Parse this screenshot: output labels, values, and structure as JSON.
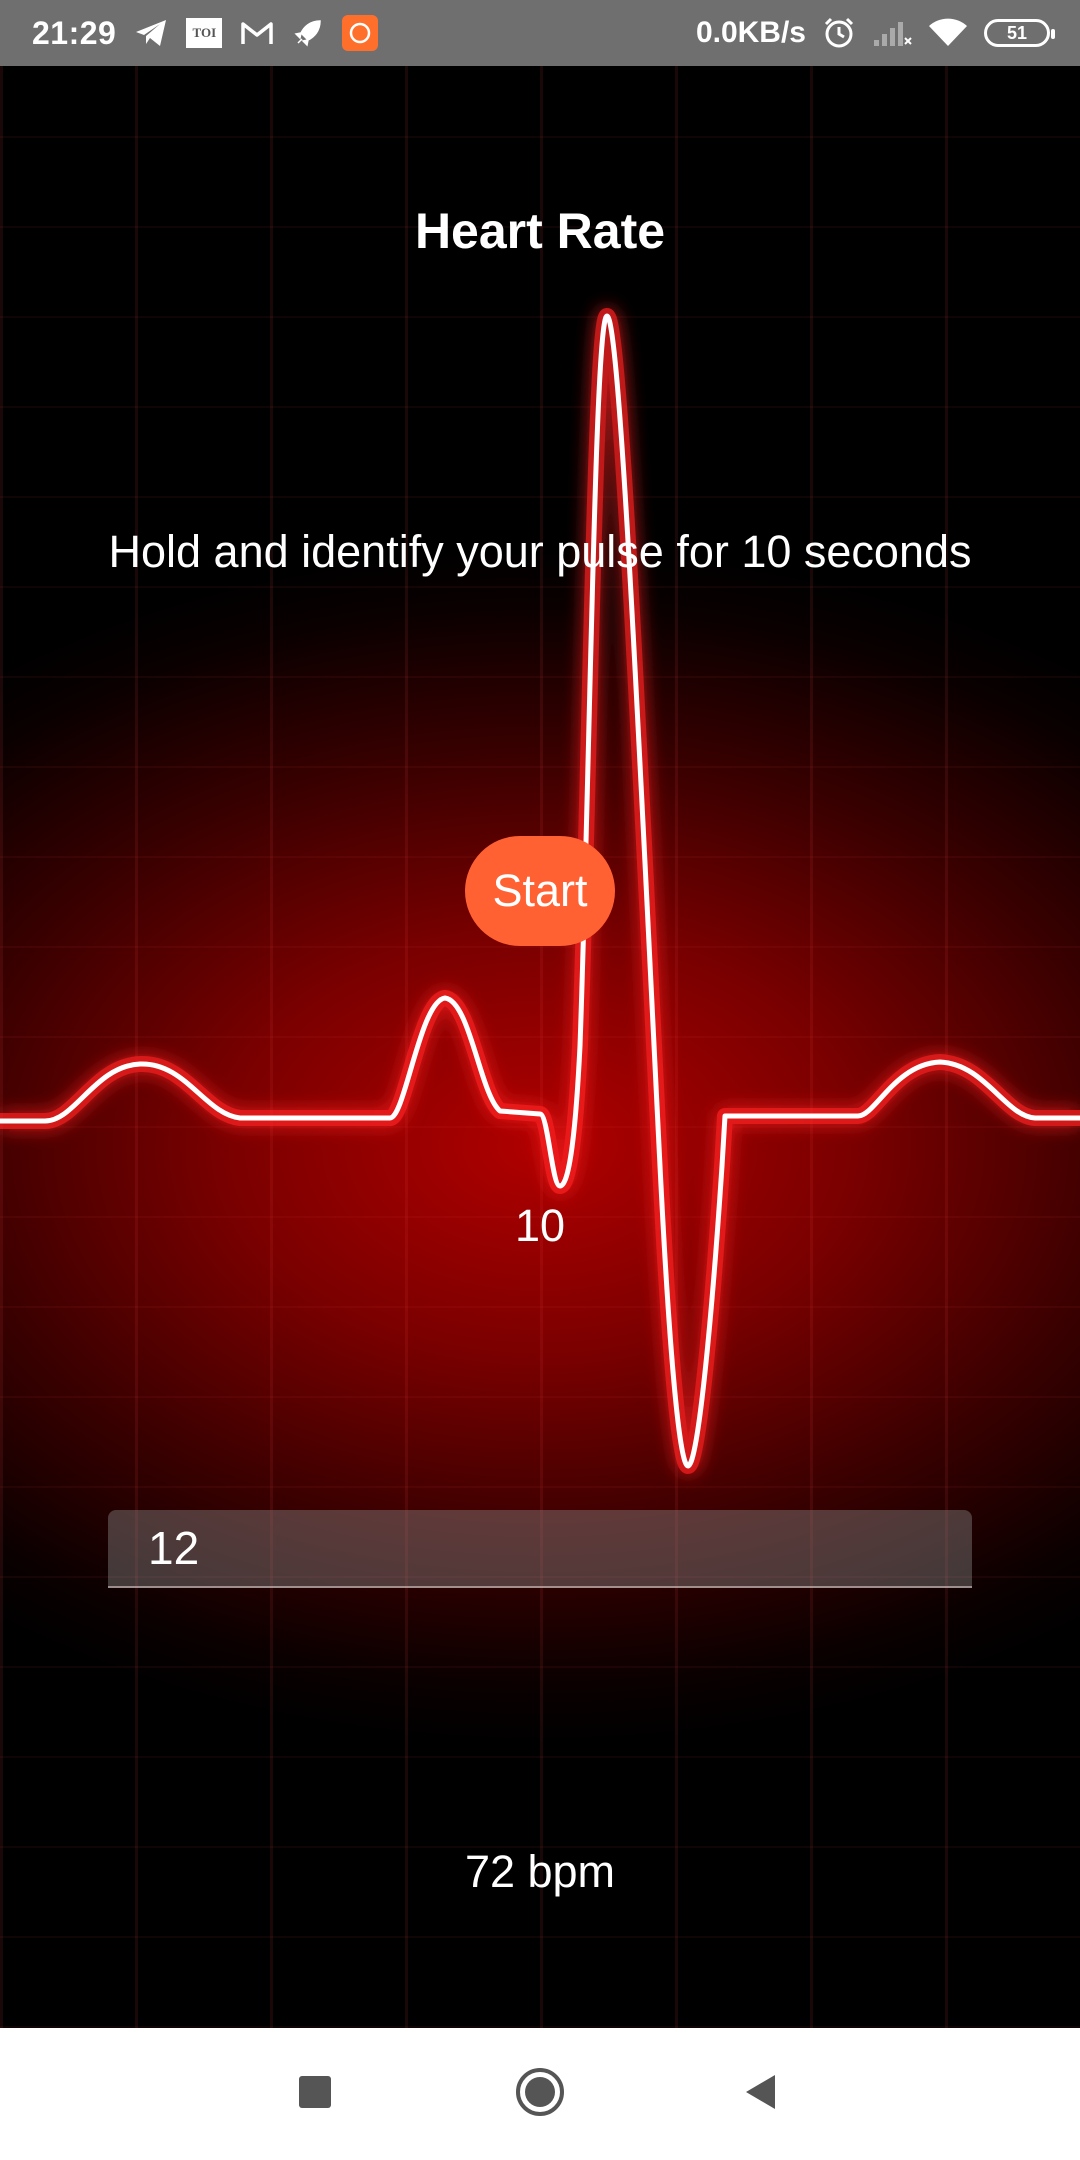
{
  "status_bar": {
    "time": "21:29",
    "toi_label": "TOI",
    "net_speed": "0.0KB/s",
    "battery": "51",
    "icons": [
      "telegram-icon",
      "toi-icon",
      "gmail-icon",
      "rocket-icon",
      "mi-icon",
      "alarm-icon",
      "signal-icon",
      "wifi-icon",
      "battery-icon"
    ]
  },
  "app": {
    "title": "Heart Rate",
    "instruction": "Hold and identify your pulse for 10 seconds",
    "start_label": "Start",
    "countdown": "10",
    "pulse_input_value": "12",
    "result": "72 bpm"
  },
  "nav_bar": {
    "icons": [
      "recents-icon",
      "home-icon",
      "back-icon"
    ]
  },
  "colors": {
    "accent": "#ff6133",
    "background": "#8b0000",
    "ecg_line": "#ffffff"
  }
}
